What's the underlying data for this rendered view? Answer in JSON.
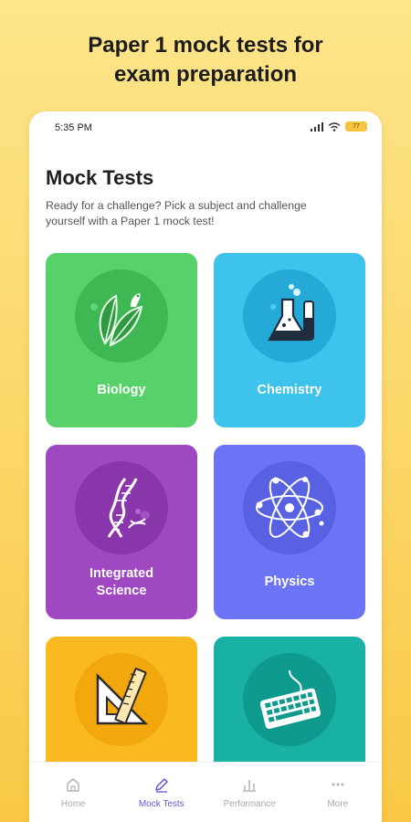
{
  "headline": {
    "line1": "Paper 1 mock tests for",
    "line2": "exam preparation"
  },
  "status_bar": {
    "time": "5:35 PM",
    "battery_text": "77"
  },
  "page": {
    "title": "Mock Tests",
    "subtitle": "Ready for a challenge? Pick a subject and challenge yourself with a Paper 1 mock test!"
  },
  "subjects": [
    {
      "label": "Biology",
      "icon": "leaf-icon",
      "color": "#57d26b"
    },
    {
      "label": "Chemistry",
      "icon": "flask-icon",
      "color": "#3dc3ec"
    },
    {
      "label_line1": "Integrated",
      "label_line2": "Science",
      "icon": "dna-icon",
      "color": "#a048c1"
    },
    {
      "label": "Physics",
      "icon": "atom-icon",
      "color": "#6b74f5"
    },
    {
      "label": "",
      "icon": "ruler-triangle-icon",
      "color": "#f9b91f"
    },
    {
      "label": "",
      "icon": "keyboard-icon",
      "color": "#18b1a3"
    }
  ],
  "nav": {
    "items": [
      {
        "label": "Home",
        "icon": "home-icon"
      },
      {
        "label": "Mock Tests",
        "icon": "pencil-icon",
        "active": true
      },
      {
        "label": "Performance",
        "icon": "bar-chart-icon"
      },
      {
        "label": "More",
        "icon": "more-dots-icon"
      }
    ],
    "active_color": "#5a5ad6"
  }
}
